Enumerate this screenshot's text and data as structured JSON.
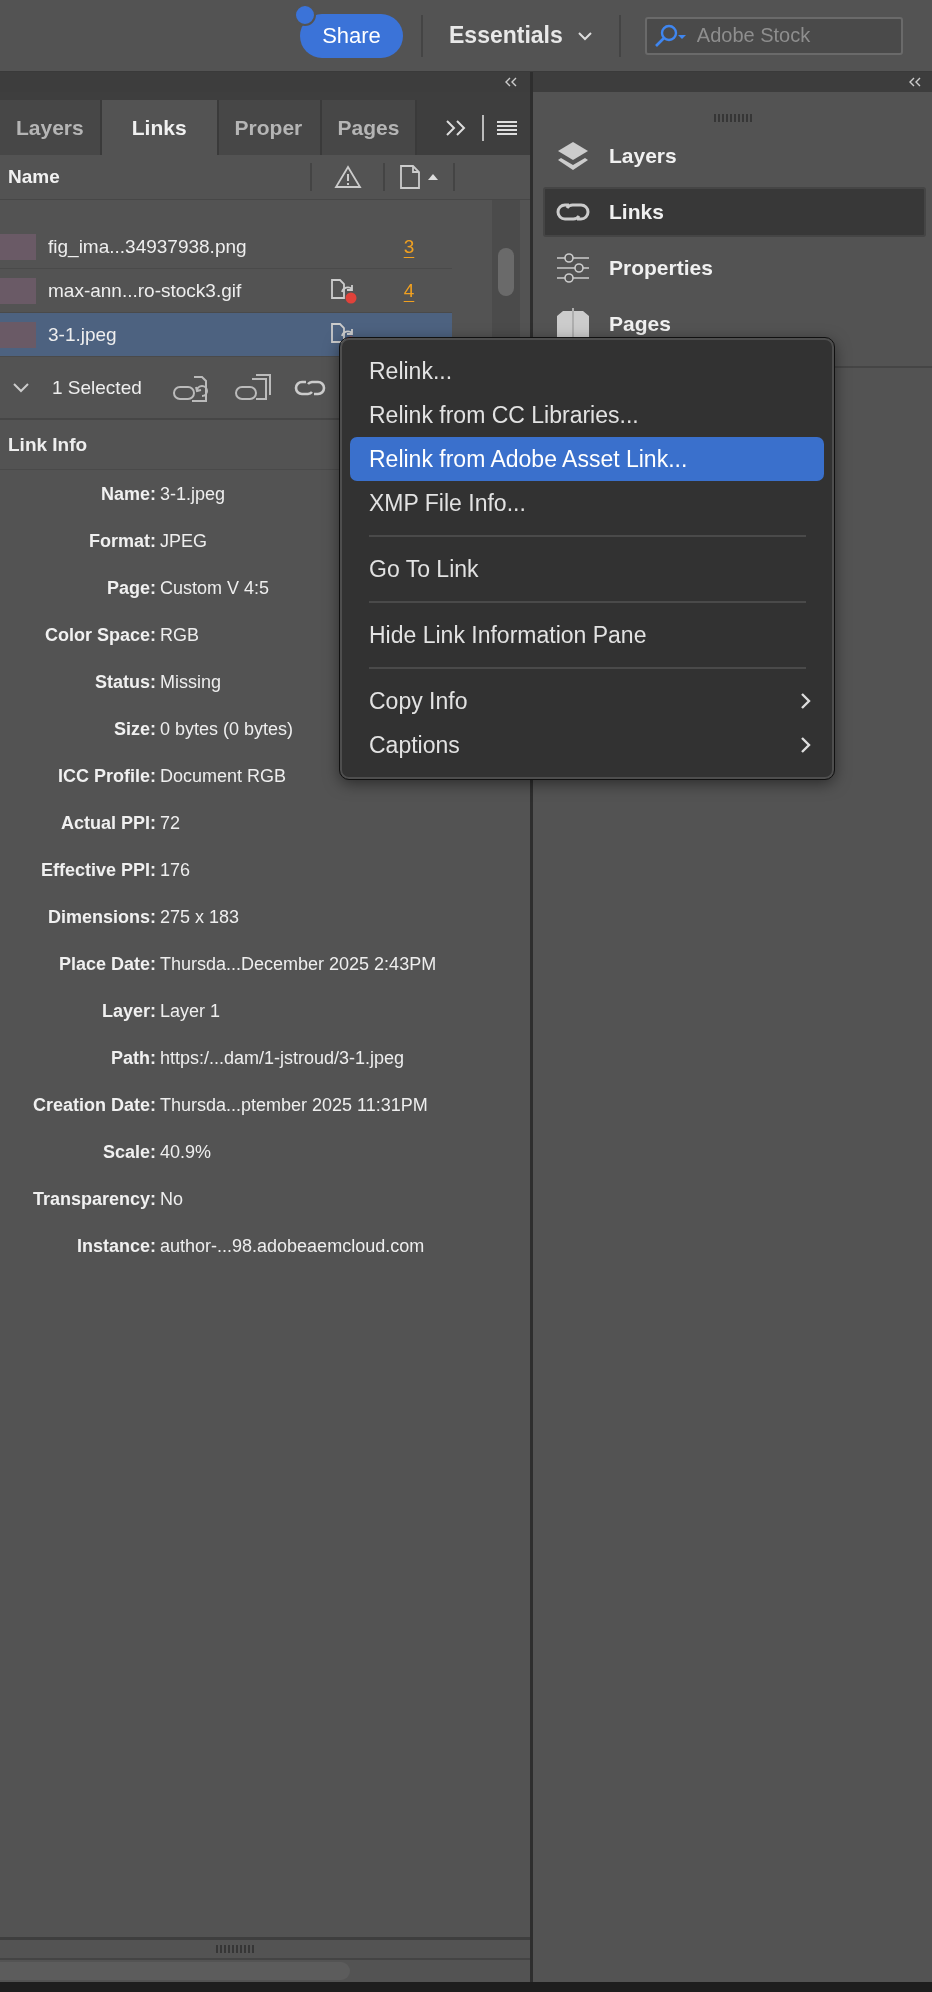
{
  "top_bar": {
    "share_button": "Share",
    "workspace": "Essentials",
    "search": {
      "placeholder": "Adobe Stock"
    }
  },
  "links_panel": {
    "tabs": [
      {
        "label": "Layers",
        "selected": false
      },
      {
        "label": "Links",
        "selected": true
      },
      {
        "label": "Proper",
        "selected": false
      },
      {
        "label": "Pages",
        "selected": false
      }
    ],
    "column_name": "Name",
    "rows": [
      {
        "name": "fig_ima...34937938.png",
        "page": "3",
        "missing": false,
        "selected": false
      },
      {
        "name": "max-ann...ro-stock3.gif",
        "page": "4",
        "missing": true,
        "selected": false
      },
      {
        "name": "3-1.jpeg",
        "missing": true,
        "selected": true
      }
    ],
    "selection": "1 Selected",
    "info_title": "Link Info",
    "info": [
      {
        "label": "Name:",
        "value": "3-1.jpeg"
      },
      {
        "label": "Format:",
        "value": "JPEG"
      },
      {
        "label": "Page:",
        "value": "Custom V 4:5"
      },
      {
        "label": "Color Space:",
        "value": "RGB"
      },
      {
        "label": "Status:",
        "value": "Missing"
      },
      {
        "label": "Size:",
        "value": "0 bytes (0 bytes)"
      },
      {
        "label": "ICC Profile:",
        "value": "Document RGB"
      },
      {
        "label": "Actual PPI:",
        "value": "72"
      },
      {
        "label": "Effective PPI:",
        "value": "176"
      },
      {
        "label": "Dimensions:",
        "value": "275 x 183"
      },
      {
        "label": "Place Date:",
        "value": "Thursda...December 2025 2:43PM"
      },
      {
        "label": "Layer:",
        "value": "Layer 1"
      },
      {
        "label": "Path:",
        "value": "https:/...dam/1-jstroud/3-1.jpeg"
      },
      {
        "label": "Creation Date:",
        "value": "Thursda...ptember 2025 11:31PM"
      },
      {
        "label": "Scale:",
        "value": "40.9%"
      },
      {
        "label": "Transparency:",
        "value": "No"
      },
      {
        "label": "Instance:",
        "value": "author-...98.adobeaemcloud.com"
      }
    ]
  },
  "dock": {
    "items": [
      {
        "kind": "layers",
        "label": "Layers",
        "selected": false
      },
      {
        "kind": "links",
        "label": "Links",
        "selected": true
      },
      {
        "kind": "properties",
        "label": "Properties",
        "selected": false
      },
      {
        "kind": "pages",
        "label": "Pages",
        "selected": false
      }
    ]
  },
  "context_menu": {
    "items": [
      {
        "kind": "item",
        "label": "Relink...",
        "selected": false,
        "submenu": false
      },
      {
        "kind": "item",
        "label": "Relink from CC Libraries...",
        "selected": false,
        "submenu": false
      },
      {
        "kind": "item",
        "label": "Relink from Adobe Asset Link...",
        "selected": true,
        "submenu": false
      },
      {
        "kind": "item",
        "label": "XMP File Info...",
        "selected": false,
        "submenu": false
      },
      {
        "kind": "separator"
      },
      {
        "kind": "item",
        "label": "Go To Link",
        "selected": false,
        "submenu": false
      },
      {
        "kind": "separator"
      },
      {
        "kind": "item",
        "label": "Hide Link Information Pane",
        "selected": false,
        "submenu": false
      },
      {
        "kind": "separator"
      },
      {
        "kind": "item",
        "label": "Copy Info",
        "selected": false,
        "submenu": true
      },
      {
        "kind": "item",
        "label": "Captions",
        "selected": false,
        "submenu": true
      }
    ]
  }
}
